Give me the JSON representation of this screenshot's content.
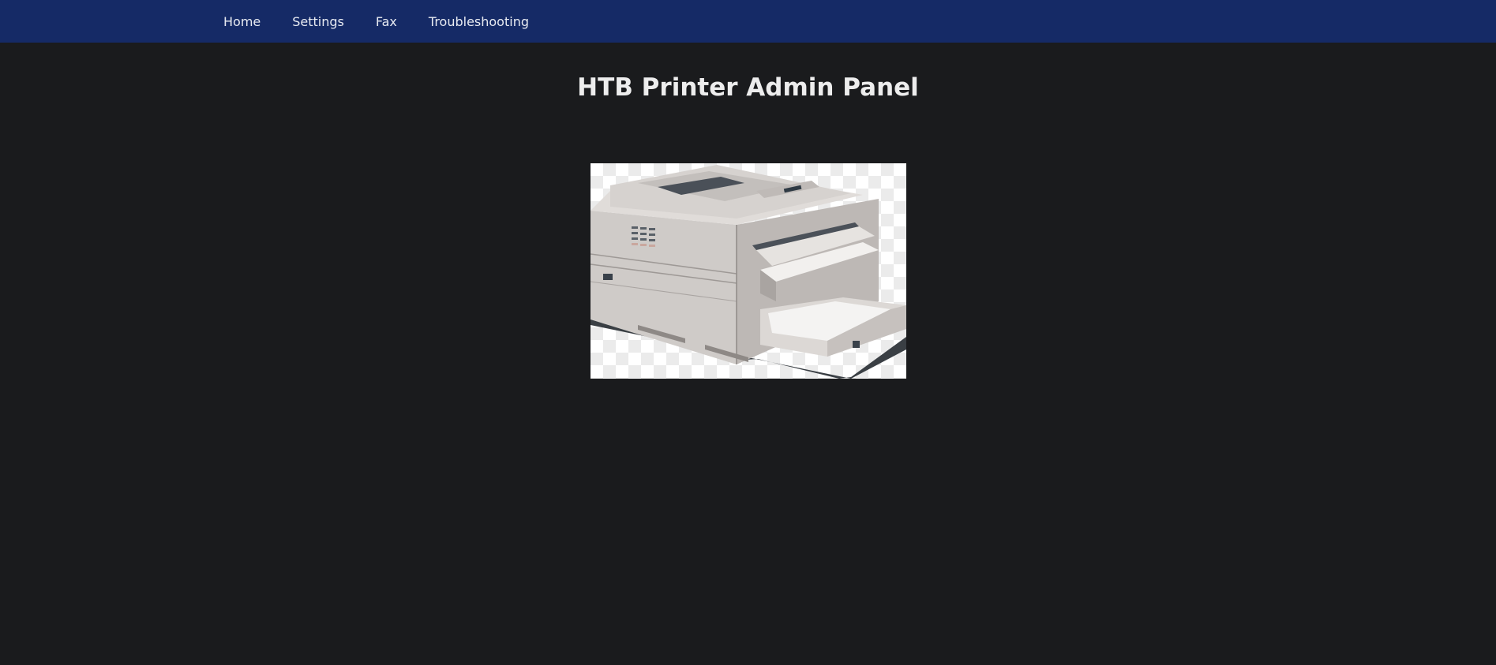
{
  "nav": {
    "items": [
      {
        "label": "Home"
      },
      {
        "label": "Settings"
      },
      {
        "label": "Fax"
      },
      {
        "label": "Troubleshooting"
      }
    ]
  },
  "main": {
    "title": "HTB Printer Admin Panel",
    "image": {
      "icon": "printer-icon"
    }
  },
  "colors": {
    "navbar": "#152a66",
    "background": "#1a1b1d",
    "nav_text": "#e8ebf2",
    "title_text": "#ededed"
  }
}
